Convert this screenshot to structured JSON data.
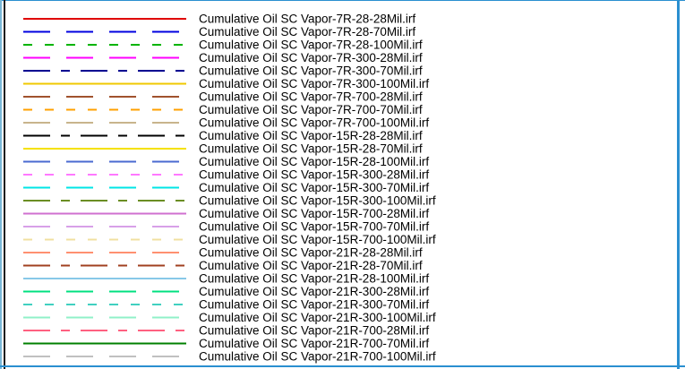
{
  "chart_data": {
    "type": "line",
    "title": "",
    "legend": {
      "placement": "full",
      "entries": [
        {
          "label": "Cumulative Oil SC Vapor-7R-28-28Mil.irf",
          "color": "#e00000",
          "dash": "solid"
        },
        {
          "label": "Cumulative Oil SC Vapor-7R-28-70Mil.irf",
          "color": "#0000e0",
          "dash": "long"
        },
        {
          "label": "Cumulative Oil SC Vapor-7R-28-100Mil.irf",
          "color": "#00b400",
          "dash": "short"
        },
        {
          "label": "Cumulative Oil SC Vapor-7R-300-28Mil.irf",
          "color": "#ff00ff",
          "dash": "long"
        },
        {
          "label": "Cumulative Oil SC Vapor-7R-300-70Mil.irf",
          "color": "#000090",
          "dash": "dashdot"
        },
        {
          "label": "Cumulative Oil SC Vapor-7R-300-100Mil.irf",
          "color": "#f0c800",
          "dash": "solid"
        },
        {
          "label": "Cumulative Oil SC Vapor-7R-700-28Mil.irf",
          "color": "#a0522d",
          "dash": "long"
        },
        {
          "label": "Cumulative Oil SC Vapor-7R-700-70Mil.irf",
          "color": "#ffa000",
          "dash": "short"
        },
        {
          "label": "Cumulative Oil SC Vapor-7R-700-100Mil.irf",
          "color": "#c8b48c",
          "dash": "long"
        },
        {
          "label": "Cumulative Oil SC Vapor-15R-28-28Mil.irf",
          "color": "#000000",
          "dash": "dashdot"
        },
        {
          "label": "Cumulative Oil SC Vapor-15R-28-70Mil.irf",
          "color": "#f5e100",
          "dash": "solid"
        },
        {
          "label": "Cumulative Oil SC Vapor-15R-28-100Mil.irf",
          "color": "#4a6ad0",
          "dash": "long"
        },
        {
          "label": "Cumulative Oil SC Vapor-15R-300-28Mil.irf",
          "color": "#ff78ff",
          "dash": "short"
        },
        {
          "label": "Cumulative Oil SC Vapor-15R-300-70Mil.irf",
          "color": "#00e6e6",
          "dash": "long"
        },
        {
          "label": "Cumulative Oil SC Vapor-15R-300-100Mil.irf",
          "color": "#6b8e23",
          "dash": "dashdot"
        },
        {
          "label": "Cumulative Oil SC Vapor-15R-700-28Mil.irf",
          "color": "#d070d0",
          "dash": "solid"
        },
        {
          "label": "Cumulative Oil SC Vapor-15R-700-70Mil.irf",
          "color": "#d8a0e8",
          "dash": "long"
        },
        {
          "label": "Cumulative Oil SC Vapor-15R-700-100Mil.irf",
          "color": "#f0e0a0",
          "dash": "short"
        },
        {
          "label": "Cumulative Oil SC Vapor-21R-28-28Mil.irf",
          "color": "#ff9070",
          "dash": "long"
        },
        {
          "label": "Cumulative Oil SC Vapor-21R-28-70Mil.irf",
          "color": "#a04020",
          "dash": "dashdot"
        },
        {
          "label": "Cumulative Oil SC Vapor-21R-28-100Mil.irf",
          "color": "#88c8e8",
          "dash": "solid"
        },
        {
          "label": "Cumulative Oil SC Vapor-21R-300-28Mil.irf",
          "color": "#00e080",
          "dash": "long"
        },
        {
          "label": "Cumulative Oil SC Vapor-21R-300-70Mil.irf",
          "color": "#40d0c0",
          "dash": "short"
        },
        {
          "label": "Cumulative Oil SC Vapor-21R-300-100Mil.irf",
          "color": "#90f0c8",
          "dash": "long"
        },
        {
          "label": "Cumulative Oil SC Vapor-21R-700-28Mil.irf",
          "color": "#ff6080",
          "dash": "dashdot"
        },
        {
          "label": "Cumulative Oil SC Vapor-21R-700-70Mil.irf",
          "color": "#008000",
          "dash": "solid"
        },
        {
          "label": "Cumulative Oil SC Vapor-21R-700-100Mil.irf",
          "color": "#c0c0c0",
          "dash": "long"
        }
      ]
    }
  }
}
